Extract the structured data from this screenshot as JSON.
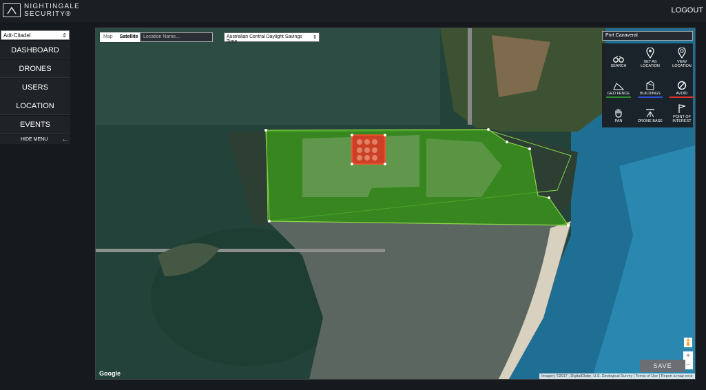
{
  "header": {
    "brand_line1": "NIGHTINGALE",
    "brand_line2": "SECURITY®",
    "logout": "LOGOUT"
  },
  "sidebar": {
    "account": "Adt-Citadel",
    "items": [
      {
        "label": "DASHBOARD"
      },
      {
        "label": "DRONES"
      },
      {
        "label": "USERS"
      },
      {
        "label": "LOCATION"
      },
      {
        "label": "EVENTS"
      }
    ],
    "hide_menu": "HIDE MENU"
  },
  "map": {
    "type_map": "Map",
    "type_satellite": "Satellite",
    "location_placeholder": "Location Name...",
    "timezone": "Australian Central Daylight Savings Time",
    "place": "Port Canaveral",
    "tools": [
      {
        "label": "SEARCH",
        "icon": "binoculars-icon"
      },
      {
        "label": "SET AS LOCATION",
        "icon": "pin-icon"
      },
      {
        "label": "VIEW LOCATION",
        "icon": "pin-view-icon"
      },
      {
        "label": "GEO FENCE",
        "icon": "geofence-icon",
        "underline": "#2e8b2e"
      },
      {
        "label": "BUILDINGS",
        "icon": "building-icon",
        "underline": "#2d4fd8"
      },
      {
        "label": "AVOID",
        "icon": "avoid-icon",
        "underline": "#d8322d"
      },
      {
        "label": "PAN",
        "icon": "hand-icon"
      },
      {
        "label": "DRONE BASE",
        "icon": "drone-base-icon"
      },
      {
        "label": "POINT OF INTEREST",
        "icon": "flag-icon"
      }
    ],
    "save": "SAVE",
    "google": "Google",
    "attribution": "Imagery ©2017 , DigitalGlobe, U.S. Geological Survey  |  Terms of Use  |  Report a map error",
    "geofence_color": "#3a9a1a",
    "avoid_color": "#e03020"
  }
}
